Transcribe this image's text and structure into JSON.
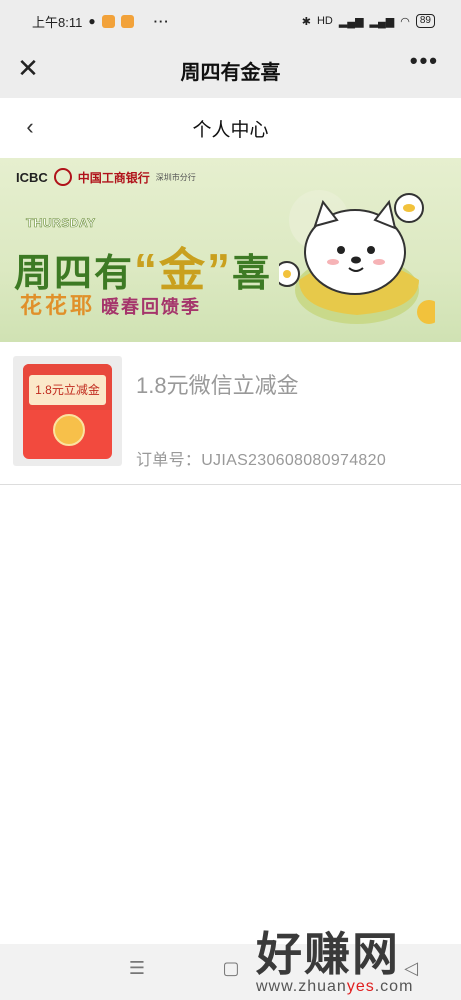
{
  "status_bar": {
    "time": "上午8:11",
    "more": "···",
    "signal_label": "HD",
    "battery": "89"
  },
  "titlebar": {
    "title": "周四有金喜",
    "close_icon": "close-icon",
    "more_icon": "more-icon",
    "more": "•••"
  },
  "page_header": {
    "back_icon": "chevron-left-icon",
    "title": "个人中心"
  },
  "banner": {
    "bank_short": "ICBC",
    "bank_name": "中国工商银行",
    "branch": "深圳市分行",
    "thursday": "THURSDAY",
    "campaign_a": "周四有",
    "campaign_gold": "“金”",
    "campaign_b": "喜",
    "slogan": "花花耶",
    "slogan_sub": "暖春回馈季"
  },
  "item": {
    "card_text": "1.8元立减金",
    "name": "1.8元微信立减金",
    "order": "订单号：UJIAS230608080974820"
  },
  "watermark": {
    "big": "好赚网",
    "small_a": "www.zhuan",
    "small_hl": "yes",
    "small_b": ".com"
  },
  "nav": {
    "menu": "☰",
    "home": "▢",
    "back": "◁"
  }
}
